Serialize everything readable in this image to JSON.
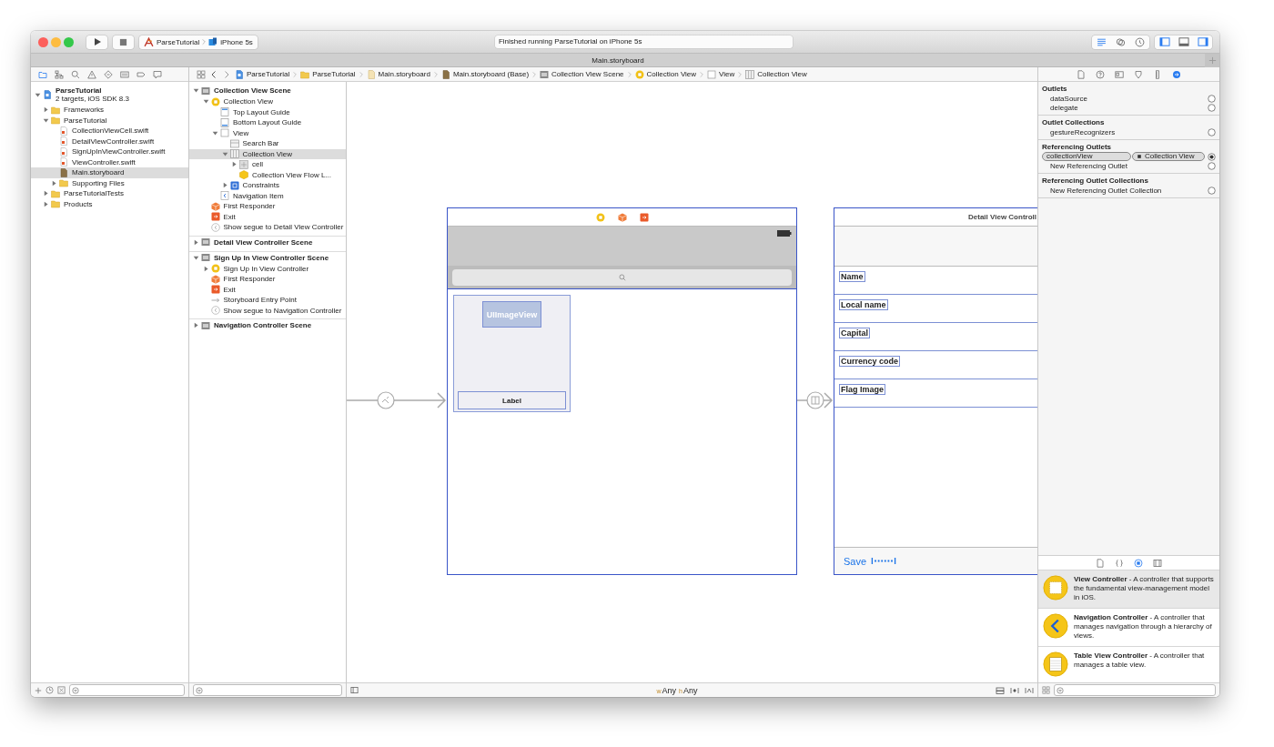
{
  "window": {
    "tab_title": "Main.storyboard"
  },
  "toolbar": {
    "scheme": "ParseTutorial",
    "device": "iPhone 5s",
    "status": "Finished running ParseTutorial on iPhone 5s",
    "editor_modes": [
      {
        "kind": "standard",
        "selected": true
      },
      {
        "kind": "assistant",
        "selected": false
      },
      {
        "kind": "version",
        "selected": false
      }
    ],
    "panels": [
      {
        "kind": "navigator",
        "on": true
      },
      {
        "kind": "debug",
        "on": false
      },
      {
        "kind": "utilities",
        "on": true
      }
    ]
  },
  "navigator": {
    "tabs": [
      {
        "kind": "project",
        "selected": true
      },
      {
        "kind": "symbol",
        "selected": false
      },
      {
        "kind": "find",
        "selected": false
      },
      {
        "kind": "issue",
        "selected": false
      },
      {
        "kind": "test",
        "selected": false
      },
      {
        "kind": "debug",
        "selected": false
      },
      {
        "kind": "breakpoint",
        "selected": false
      },
      {
        "kind": "report",
        "selected": false
      }
    ],
    "items": [
      {
        "label": "ParseTutorial",
        "subtitle": "2 targets, iOS SDK 8.3",
        "kind": "project",
        "expanded": true,
        "selected": false,
        "children": [
          {
            "label": "Frameworks",
            "kind": "folder",
            "expanded": false,
            "selected": false
          },
          {
            "label": "ParseTutorial",
            "kind": "folder",
            "expanded": true,
            "selected": false,
            "children": [
              {
                "label": "CollectionViewCell.swift",
                "kind": "swift",
                "selected": false
              },
              {
                "label": "DetailViewController.swift",
                "kind": "swift",
                "selected": false
              },
              {
                "label": "SignUpInViewController.swift",
                "kind": "swift",
                "selected": false
              },
              {
                "label": "ViewController.swift",
                "kind": "swift",
                "selected": false
              },
              {
                "label": "Main.storyboard",
                "kind": "storyboard",
                "selected": true
              },
              {
                "label": "Supporting Files",
                "kind": "folder",
                "expanded": false,
                "selected": false
              }
            ]
          },
          {
            "label": "ParseTutorialTests",
            "kind": "folder",
            "expanded": false,
            "selected": false
          },
          {
            "label": "Products",
            "kind": "folder",
            "expanded": false,
            "selected": false
          }
        ]
      }
    ]
  },
  "breadcrumb": [
    {
      "label": "ParseTutorial",
      "kind": "project"
    },
    {
      "label": "ParseTutorial",
      "kind": "folder"
    },
    {
      "label": "Main.storyboard",
      "kind": "storyboard-light"
    },
    {
      "label": "Main.storyboard (Base)",
      "kind": "storyboard"
    },
    {
      "label": "Collection View Scene",
      "kind": "scene"
    },
    {
      "label": "Collection View",
      "kind": "controller"
    },
    {
      "label": "View",
      "kind": "view"
    },
    {
      "label": "Collection View",
      "kind": "collection"
    }
  ],
  "outline": [
    {
      "label": "Collection View Scene",
      "kind": "scene",
      "expanded": true,
      "selected": false,
      "children": [
        {
          "label": "Collection View",
          "kind": "controller",
          "expanded": true,
          "selected": false,
          "children": [
            {
              "label": "Top Layout Guide",
              "kind": "top-guide",
              "selected": false
            },
            {
              "label": "Bottom Layout Guide",
              "kind": "bottom-guide",
              "selected": false
            },
            {
              "label": "View",
              "kind": "view",
              "expanded": true,
              "selected": false,
              "children": [
                {
                  "label": "Search Bar",
                  "kind": "search-bar",
                  "selected": false
                },
                {
                  "label": "Collection View",
                  "kind": "collection",
                  "expanded": true,
                  "selected": true,
                  "children": [
                    {
                      "label": "cell",
                      "kind": "cell",
                      "expanded": false,
                      "selected": false
                    },
                    {
                      "label": "Collection View Flow L...",
                      "kind": "layout-object",
                      "selected": false
                    }
                  ]
                },
                {
                  "label": "Constraints",
                  "kind": "constraints",
                  "expanded": false,
                  "selected": false
                }
              ]
            },
            {
              "label": "Navigation Item",
              "kind": "nav-item",
              "selected": false
            }
          ]
        },
        {
          "label": "First Responder",
          "kind": "responder",
          "selected": false
        },
        {
          "label": "Exit",
          "kind": "exit",
          "selected": false
        },
        {
          "label": "Show segue to Detail View Controller",
          "kind": "segue",
          "selected": false
        }
      ]
    },
    {
      "label": "Detail View Controller Scene",
      "kind": "scene",
      "expanded": false,
      "selected": false
    },
    {
      "label": "Sign Up In View Controller Scene",
      "kind": "scene",
      "expanded": true,
      "selected": false,
      "children": [
        {
          "label": "Sign Up In View Controller",
          "kind": "controller",
          "expanded": false,
          "selected": false
        },
        {
          "label": "First Responder",
          "kind": "responder",
          "selected": false
        },
        {
          "label": "Exit",
          "kind": "exit",
          "selected": false
        },
        {
          "label": "Storyboard Entry Point",
          "kind": "entry",
          "selected": false
        },
        {
          "label": "Show segue to Navigation Controller",
          "kind": "segue",
          "selected": false
        }
      ]
    },
    {
      "label": "Navigation Controller Scene",
      "kind": "scene",
      "expanded": false,
      "selected": false
    }
  ],
  "canvas": {
    "master": {
      "image_view": "UIImageView",
      "label": "Label"
    },
    "detail": {
      "title": "Detail View Controll",
      "fields": [
        "Name",
        "Local name",
        "Capital",
        "Currency code",
        "Flag Image"
      ],
      "toolbar_button": "Save"
    },
    "size_class": [
      {
        "axis": "w",
        "value": "Any"
      },
      {
        "axis": "h",
        "value": "Any"
      }
    ]
  },
  "inspector": {
    "tabs": [
      {
        "kind": "file",
        "selected": false
      },
      {
        "kind": "help",
        "selected": false
      },
      {
        "kind": "identity",
        "selected": false
      },
      {
        "kind": "attributes",
        "selected": false
      },
      {
        "kind": "size",
        "selected": false
      },
      {
        "kind": "connections",
        "selected": true
      }
    ],
    "sections": [
      {
        "title": "Outlets",
        "rows": [
          {
            "label": "dataSource",
            "connected": false
          },
          {
            "label": "delegate",
            "connected": false
          }
        ]
      },
      {
        "title": "Outlet Collections",
        "rows": [
          {
            "label": "gestureRecognizers",
            "connected": false
          }
        ]
      },
      {
        "title": "Referencing Outlets",
        "rows": [
          {
            "label": "collectionView",
            "target": "Collection View",
            "connected": true
          },
          {
            "label": "New Referencing Outlet",
            "connected": false
          }
        ]
      },
      {
        "title": "Referencing Outlet Collections",
        "rows": [
          {
            "label": "New Referencing Outlet Collection",
            "connected": false
          }
        ]
      }
    ]
  },
  "library": {
    "tabs": [
      {
        "kind": "file",
        "selected": false
      },
      {
        "kind": "snippet",
        "selected": false
      },
      {
        "kind": "object",
        "selected": true
      },
      {
        "kind": "media",
        "selected": false
      }
    ],
    "items": [
      {
        "kind": "view-controller",
        "text": "**View Controller** - A controller that supports the fundamental view-management model in iOS.",
        "selected": true
      },
      {
        "kind": "navigation-controller",
        "text": "**Navigation Controller** - A controller that manages navigation through a hierarchy of views.",
        "selected": false
      },
      {
        "kind": "table-view-controller",
        "text": "**Table View Controller** - A controller that manages a table view.",
        "selected": false
      }
    ]
  }
}
